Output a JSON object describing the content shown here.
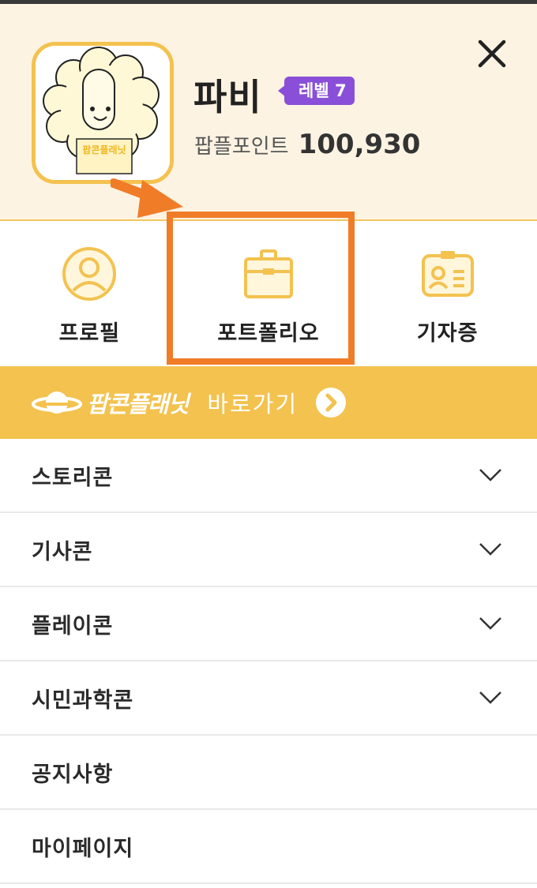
{
  "header": {
    "user_name": "파비",
    "level_badge": "레벨 7",
    "points_label": "팝플포인트",
    "points_value": "100,930",
    "avatar_label": "팝콘플래닛"
  },
  "quick_nav": [
    {
      "label": "프로필",
      "icon": "profile-icon"
    },
    {
      "label": "포트폴리오",
      "icon": "briefcase-icon"
    },
    {
      "label": "기자증",
      "icon": "press-id-icon"
    }
  ],
  "banner": {
    "brand": "팝콘플래닛",
    "goto_label": "바로가기"
  },
  "menu": [
    {
      "label": "스토리콘",
      "expandable": true
    },
    {
      "label": "기사콘",
      "expandable": true
    },
    {
      "label": "플레이콘",
      "expandable": true
    },
    {
      "label": "시민과학콘",
      "expandable": true
    },
    {
      "label": "공지사항",
      "expandable": false
    },
    {
      "label": "마이페이지",
      "expandable": false
    }
  ],
  "colors": {
    "accent_yellow": "#f3c24f",
    "header_bg": "#fdf3e3",
    "level_purple": "#8a4fd8",
    "highlight_orange": "#f07c28"
  }
}
